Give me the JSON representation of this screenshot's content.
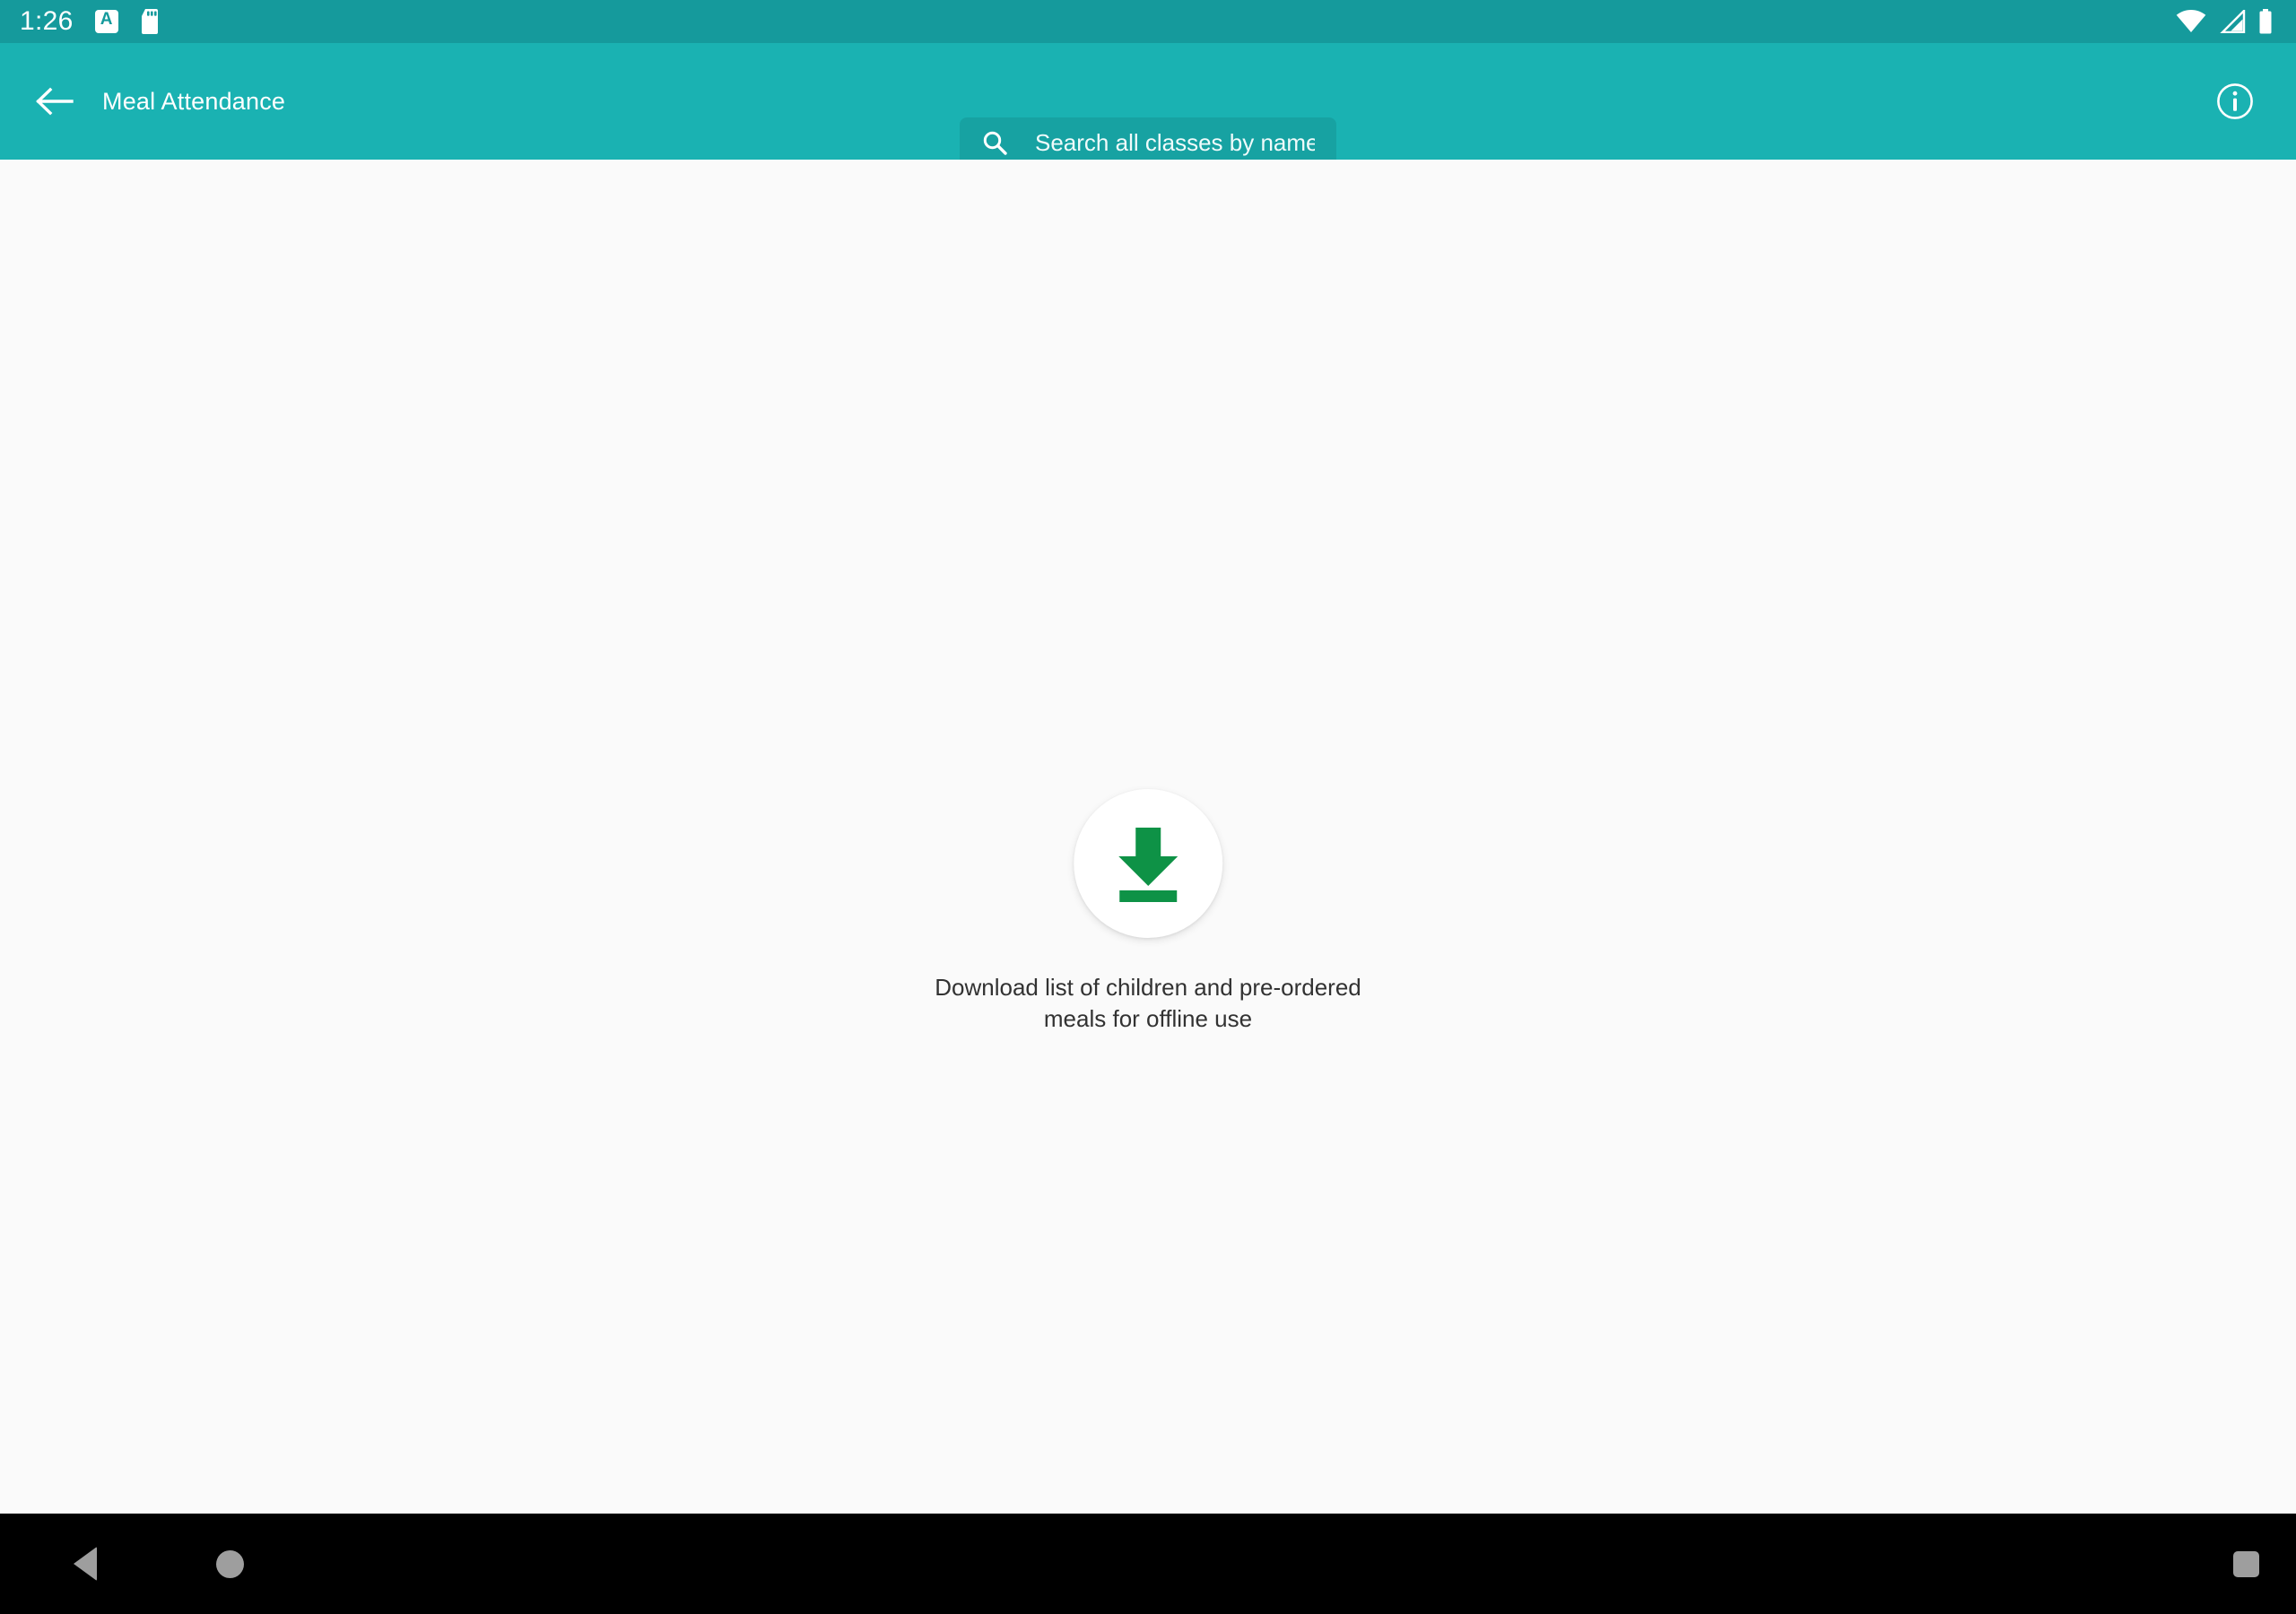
{
  "status_bar": {
    "clock": "1:26",
    "left_icons": [
      {
        "name": "app-indicator-a-icon",
        "glyph": "A"
      },
      {
        "name": "sd-card-icon",
        "glyph": "sd-card"
      }
    ],
    "right_icons": [
      {
        "name": "wifi-icon",
        "glyph": "wifi"
      },
      {
        "name": "cellular-signal-icon",
        "glyph": "signal"
      },
      {
        "name": "battery-icon",
        "glyph": "battery-full"
      }
    ],
    "background_color": "#159A9C",
    "foreground_color": "#FFFFFF"
  },
  "toolbar": {
    "back_icon": "arrow-left-icon",
    "title": "Meal Attendance",
    "info_icon": "info-outline-icon",
    "background_color": "#1AB2B2",
    "title_color": "#FFFFFF"
  },
  "search": {
    "icon": "search-icon",
    "value": "",
    "placeholder": "Search all classes by name",
    "background_color": "rgba(0,0,0,0.085)"
  },
  "empty_state": {
    "download_icon": "download-icon",
    "icon_color": "#0E9246",
    "fab_background": "#FFFFFF",
    "message": "Download list of children and pre-ordered\nmeals for offline use",
    "message_color": "#323232"
  },
  "navigation_bar": {
    "background_color": "#000000",
    "icon_color": "#9E9E9E",
    "buttons": [
      {
        "name": "nav-back-button",
        "glyph": "triangle-left"
      },
      {
        "name": "nav-home-button",
        "glyph": "circle"
      },
      {
        "name": "nav-recents-button",
        "glyph": "square"
      }
    ]
  },
  "page": {
    "background_color": "#FAFAFA"
  }
}
